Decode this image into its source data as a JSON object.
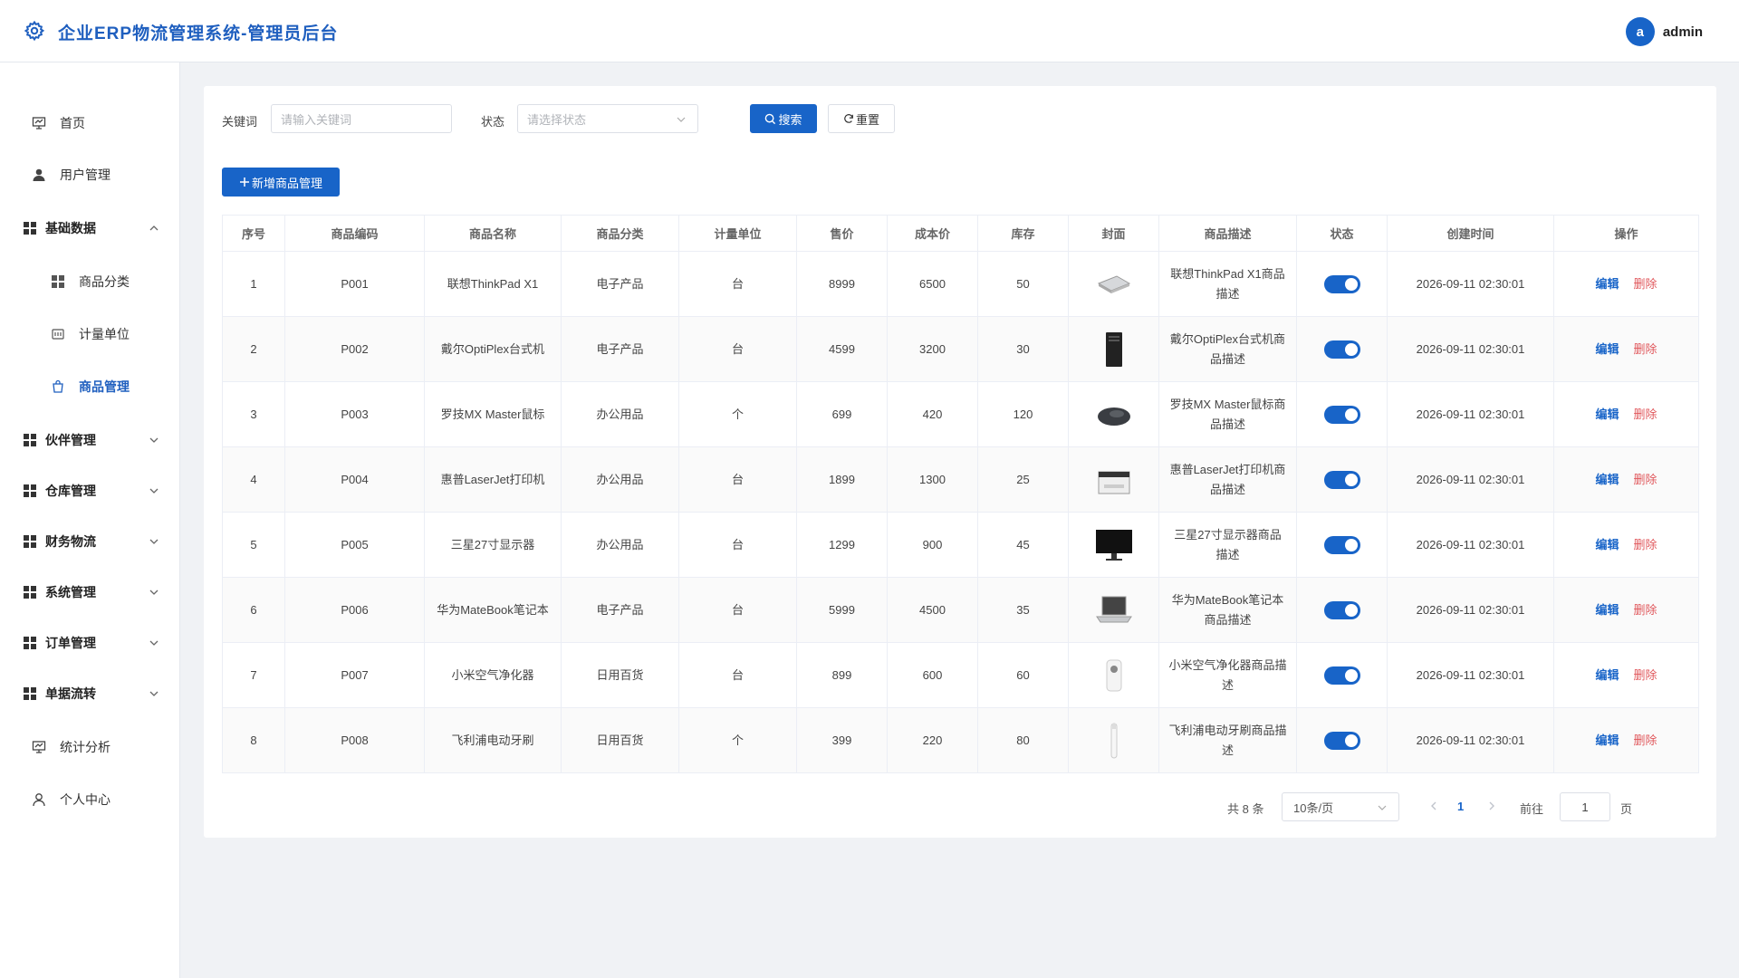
{
  "header": {
    "title": "企业ERP物流管理系统-管理员后台",
    "avatar_letter": "a",
    "username": "admin"
  },
  "sidebar": {
    "home": "首页",
    "users": "用户管理",
    "basic": "基础数据",
    "basic_children": [
      "商品分类",
      "计量单位",
      "商品管理"
    ],
    "groups": [
      "伙伴管理",
      "仓库管理",
      "财务物流",
      "系统管理",
      "订单管理",
      "单据流转"
    ],
    "stats": "统计分析",
    "profile": "个人中心"
  },
  "filter": {
    "keyword_label": "关键词",
    "keyword_placeholder": "请输入关键词",
    "status_label": "状态",
    "status_placeholder": "请选择状态",
    "search": "搜索",
    "reset": "重置"
  },
  "add_button": "新增商品管理",
  "table": {
    "headers": [
      "序号",
      "商品编码",
      "商品名称",
      "商品分类",
      "计量单位",
      "售价",
      "成本价",
      "库存",
      "封面",
      "商品描述",
      "状态",
      "创建时间",
      "操作"
    ],
    "rows": [
      {
        "no": "1",
        "code": "P001",
        "name": "联想ThinkPad X1",
        "category": "电子产品",
        "unit": "台",
        "price": "8999",
        "cost": "6500",
        "stock": "50",
        "cover": "laptop-icon",
        "desc": "联想ThinkPad X1商品描述",
        "enabled": true,
        "created": "2026-09-11 02:30:01"
      },
      {
        "no": "2",
        "code": "P002",
        "name": "戴尔OptiPlex台式机",
        "category": "电子产品",
        "unit": "台",
        "price": "4599",
        "cost": "3200",
        "stock": "30",
        "cover": "desktop-icon",
        "desc": "戴尔OptiPlex台式机商品描述",
        "enabled": true,
        "created": "2026-09-11 02:30:01"
      },
      {
        "no": "3",
        "code": "P003",
        "name": "罗技MX Master鼠标",
        "category": "办公用品",
        "unit": "个",
        "price": "699",
        "cost": "420",
        "stock": "120",
        "cover": "mouse-icon",
        "desc": "罗技MX Master鼠标商品描述",
        "enabled": true,
        "created": "2026-09-11 02:30:01"
      },
      {
        "no": "4",
        "code": "P004",
        "name": "惠普LaserJet打印机",
        "category": "办公用品",
        "unit": "台",
        "price": "1899",
        "cost": "1300",
        "stock": "25",
        "cover": "printer-icon",
        "desc": "惠普LaserJet打印机商品描述",
        "enabled": true,
        "created": "2026-09-11 02:30:01"
      },
      {
        "no": "5",
        "code": "P005",
        "name": "三星27寸显示器",
        "category": "办公用品",
        "unit": "台",
        "price": "1299",
        "cost": "900",
        "stock": "45",
        "cover": "monitor-icon",
        "desc": "三星27寸显示器商品描述",
        "enabled": true,
        "created": "2026-09-11 02:30:01"
      },
      {
        "no": "6",
        "code": "P006",
        "name": "华为MateBook笔记本",
        "category": "电子产品",
        "unit": "台",
        "price": "5999",
        "cost": "4500",
        "stock": "35",
        "cover": "notebook-icon",
        "desc": "华为MateBook笔记本商品描述",
        "enabled": true,
        "created": "2026-09-11 02:30:01"
      },
      {
        "no": "7",
        "code": "P007",
        "name": "小米空气净化器",
        "category": "日用百货",
        "unit": "台",
        "price": "899",
        "cost": "600",
        "stock": "60",
        "cover": "purifier-icon",
        "desc": "小米空气净化器商品描述",
        "enabled": true,
        "created": "2026-09-11 02:30:01"
      },
      {
        "no": "8",
        "code": "P008",
        "name": "飞利浦电动牙刷",
        "category": "日用百货",
        "unit": "个",
        "price": "399",
        "cost": "220",
        "stock": "80",
        "cover": "toothbrush-icon",
        "desc": "飞利浦电动牙刷商品描述",
        "enabled": true,
        "created": "2026-09-11 02:30:01"
      }
    ],
    "edit": "编辑",
    "delete": "删除"
  },
  "pagination": {
    "total": "共 8 条",
    "page_size": "10条/页",
    "current": "1",
    "goto": "前往",
    "jump_value": "1",
    "suffix": "页"
  },
  "colors": {
    "primary": "#1864c8",
    "danger": "#e0575b"
  }
}
